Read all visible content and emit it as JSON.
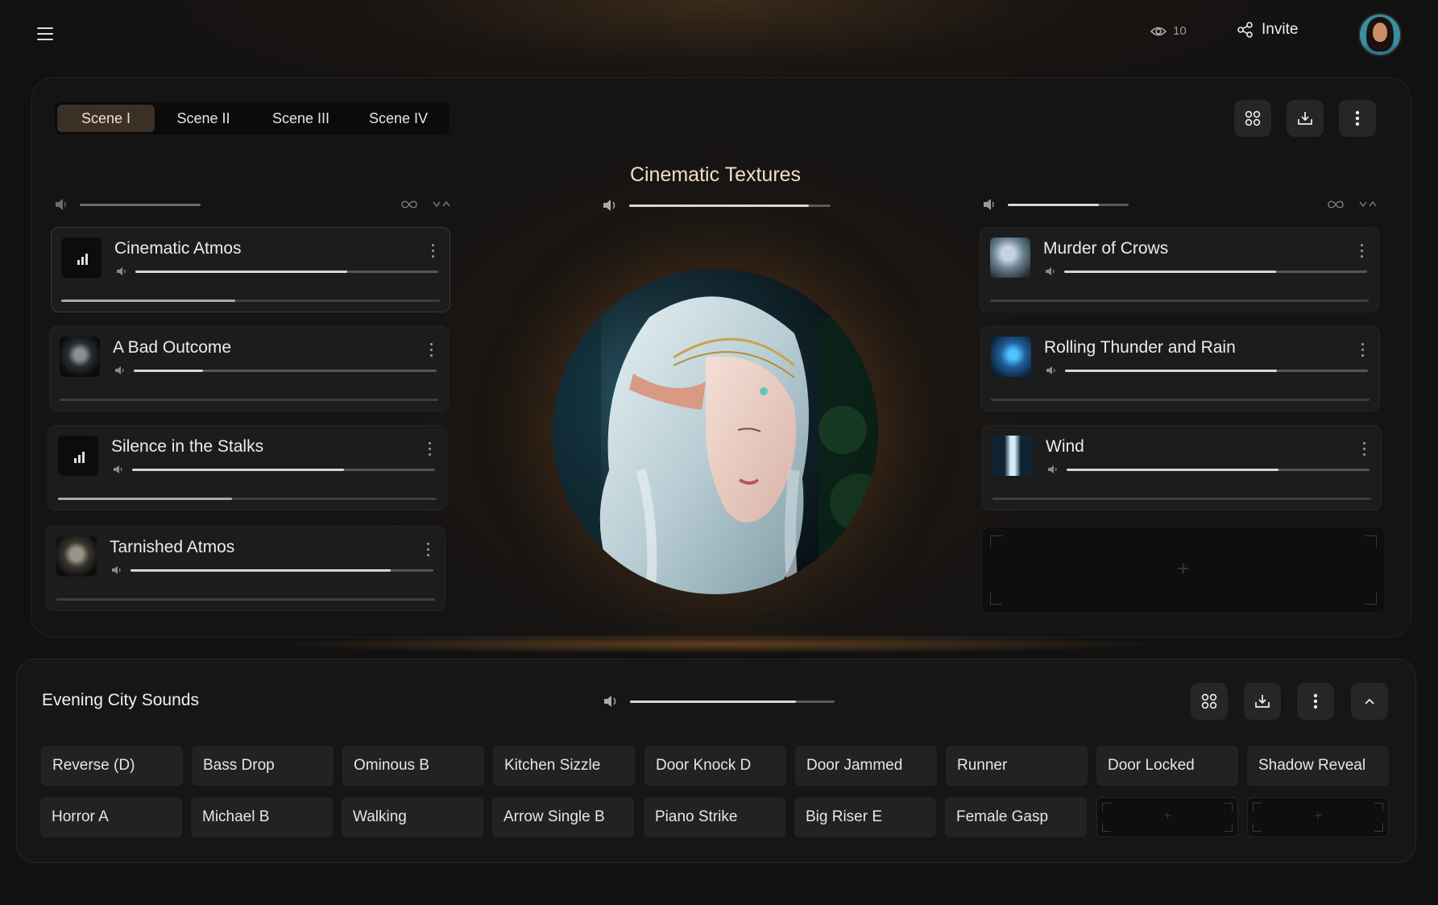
{
  "topbar": {
    "viewer_count": "10",
    "invite_label": "Invite"
  },
  "scenes": {
    "tabs": [
      "Scene I",
      "Scene II",
      "Scene III",
      "Scene IV"
    ],
    "active": "Scene I"
  },
  "panel": {
    "title": "Cinematic Textures",
    "master_volume": 0.89,
    "left_volume": 1.0,
    "right_volume": 0.75
  },
  "left_tracks": [
    {
      "title": "Cinematic Atmos",
      "volume": 0.7,
      "progress": 0.46,
      "icon": "bars-icon"
    },
    {
      "title": "A Bad Outcome",
      "volume": 0.23,
      "progress": 0.0,
      "icon": "creature-art"
    },
    {
      "title": "Silence in the Stalks",
      "volume": 0.7,
      "progress": 0.46,
      "icon": "bars-icon"
    },
    {
      "title": "Tarnished Atmos",
      "volume": 0.86,
      "progress": 0.0,
      "icon": "skull-art"
    }
  ],
  "right_tracks": [
    {
      "title": "Murder of Crows",
      "volume": 0.7,
      "progress": 0.0,
      "icon": "crow-art"
    },
    {
      "title": "Rolling Thunder and Rain",
      "volume": 0.7,
      "progress": 0.0,
      "icon": "storm-art"
    },
    {
      "title": "Wind",
      "volume": 0.7,
      "progress": 0.0,
      "icon": "waterfall-art"
    }
  ],
  "bottom": {
    "title": "Evening City Sounds",
    "volume": 0.81,
    "sfx_row1": [
      "Reverse (D)",
      "Bass Drop",
      "Ominous B",
      "Kitchen Sizzle",
      "Door Knock D",
      "Door Jammed",
      "Runner",
      "Door Locked",
      "Shadow Reveal"
    ],
    "sfx_row2": [
      "Horror A",
      "Michael B",
      "Walking",
      "Arrow Single B",
      "Piano Strike",
      "Big Riser E",
      "Female Gasp"
    ]
  },
  "colors": {
    "accent": "#f1dfc4",
    "active_tab_bg": "#3a3026",
    "card_bg": "#1c1c1c"
  }
}
